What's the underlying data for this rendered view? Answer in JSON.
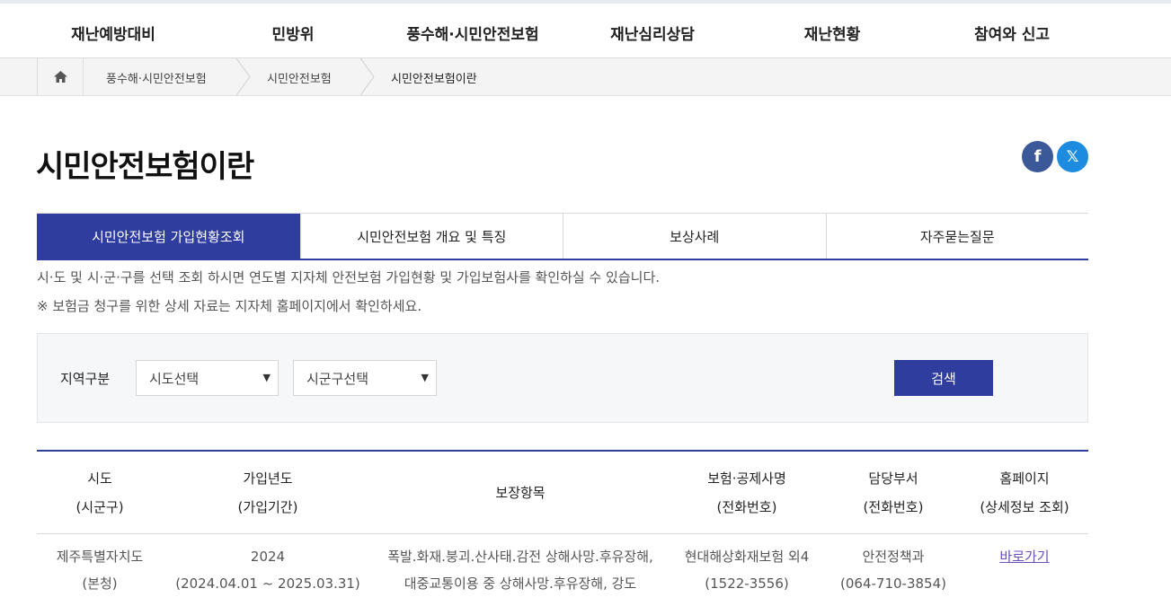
{
  "top_nav": [
    "재난예방대비",
    "민방위",
    "풍수해·시민안전보험",
    "재난심리상담",
    "재난현황",
    "참여와 신고"
  ],
  "breadcrumb": [
    "풍수해·시민안전보험",
    "시민안전보험",
    "시민안전보험이란"
  ],
  "page_title": "시민안전보험이란",
  "sns": {
    "facebook": "f",
    "x": "𝕏"
  },
  "tabs": [
    "시민안전보험 가입현황조회",
    "시민안전보험 개요 및 특징",
    "보상사례",
    "자주묻는질문"
  ],
  "desc": [
    "시·도 및 시·군·구를 선택 조회 하시면 연도별 지자체 안전보험 가입현황 및 가입보험사를 확인하실 수 있습니다.",
    "※ 보험금 청구를 위한 상세 자료는 지자체 홈페이지에서 확인하세요."
  ],
  "search": {
    "label": "지역구분",
    "sido": "시도선택",
    "sigungu": "시군구선택",
    "button": "검색"
  },
  "table": {
    "headers": [
      [
        "시도",
        "(시군구)"
      ],
      [
        "가입년도",
        "(가입기간)"
      ],
      [
        "보장항목"
      ],
      [
        "보험·공제사명",
        "(전화번호)"
      ],
      [
        "담당부서",
        "(전화번호)"
      ],
      [
        "홈페이지",
        "(상세정보 조회)"
      ]
    ],
    "rows": [
      {
        "sido": [
          "제주특별자치도",
          "(본청)"
        ],
        "year": [
          "2024",
          "(2024.04.01 ~ 2025.03.31)"
        ],
        "coverage": [
          "폭발.화재.붕괴.산사태.감전 상해사망.후유장해,",
          "대중교통이용 중 상해사망.후유장해, 강도"
        ],
        "insurer": [
          "현대해상화재보험 외4",
          "(1522-3556)"
        ],
        "dept": [
          "안전정책과",
          "(064-710-3854)"
        ],
        "link": "바로가기"
      }
    ]
  }
}
